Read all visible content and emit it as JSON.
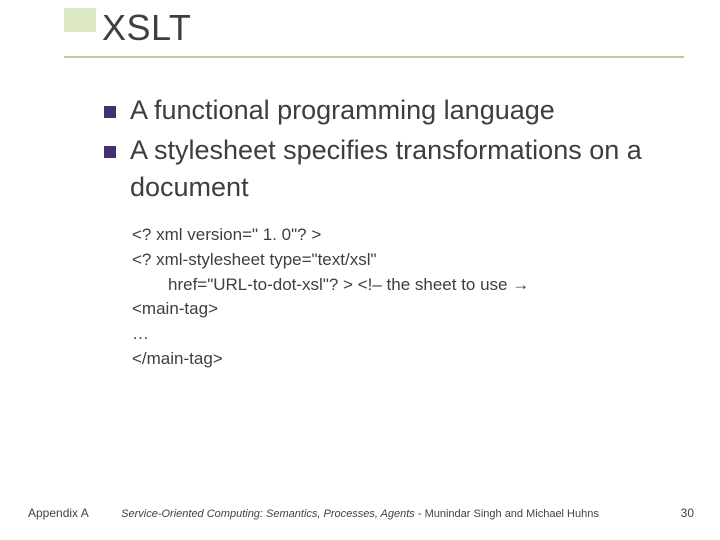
{
  "title": "XSLT",
  "bullets": [
    "A functional programming language",
    "A stylesheet specifies transformations on a document"
  ],
  "code": {
    "line1": "<? xml version=\" 1. 0\"? >",
    "line2": "<? xml-stylesheet type=\"text/xsl\"",
    "line3": "href=\"URL-to-dot-xsl\"? > <!– the sheet to use →",
    "line4": "<main-tag>",
    "line5": "…",
    "line6": "</main-tag>"
  },
  "footer": {
    "left": "Appendix A",
    "center_italic": "Service-Oriented Computing: Semantics, Processes, Agents",
    "center_plain": " - Munindar Singh and Michael Huhns",
    "right": "30"
  }
}
